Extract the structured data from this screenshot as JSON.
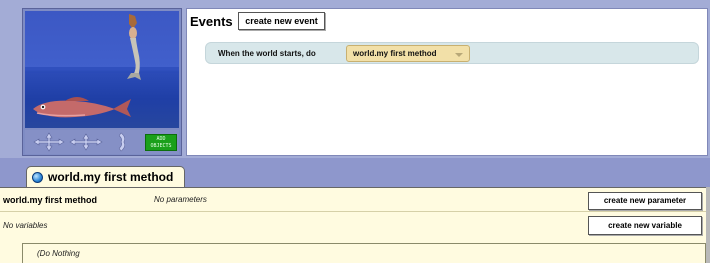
{
  "scene": {
    "add_objects_label": "ADD OBJECTS",
    "sky_color": "#3c58c4",
    "water_color": "#1f3fa6"
  },
  "events": {
    "title": "Events",
    "create_event_label": "create new event",
    "rows": [
      {
        "trigger_label": "When the world starts, do",
        "method_label": "world.my first method"
      }
    ]
  },
  "editor": {
    "tab_label": "world.my first method",
    "method_name": "world.my first method",
    "params_text": "No parameters",
    "create_param_label": "create new parameter",
    "vars_text": "No variables",
    "create_var_label": "create new variable",
    "body_text": "Do Nothing"
  },
  "colors": {
    "background": "#a3acd6",
    "editor_bg": "#fffbe0",
    "event_row": "#d8e7ea",
    "method_chip": "#f2e0a8",
    "add_objects_green": "#1aa01a"
  }
}
